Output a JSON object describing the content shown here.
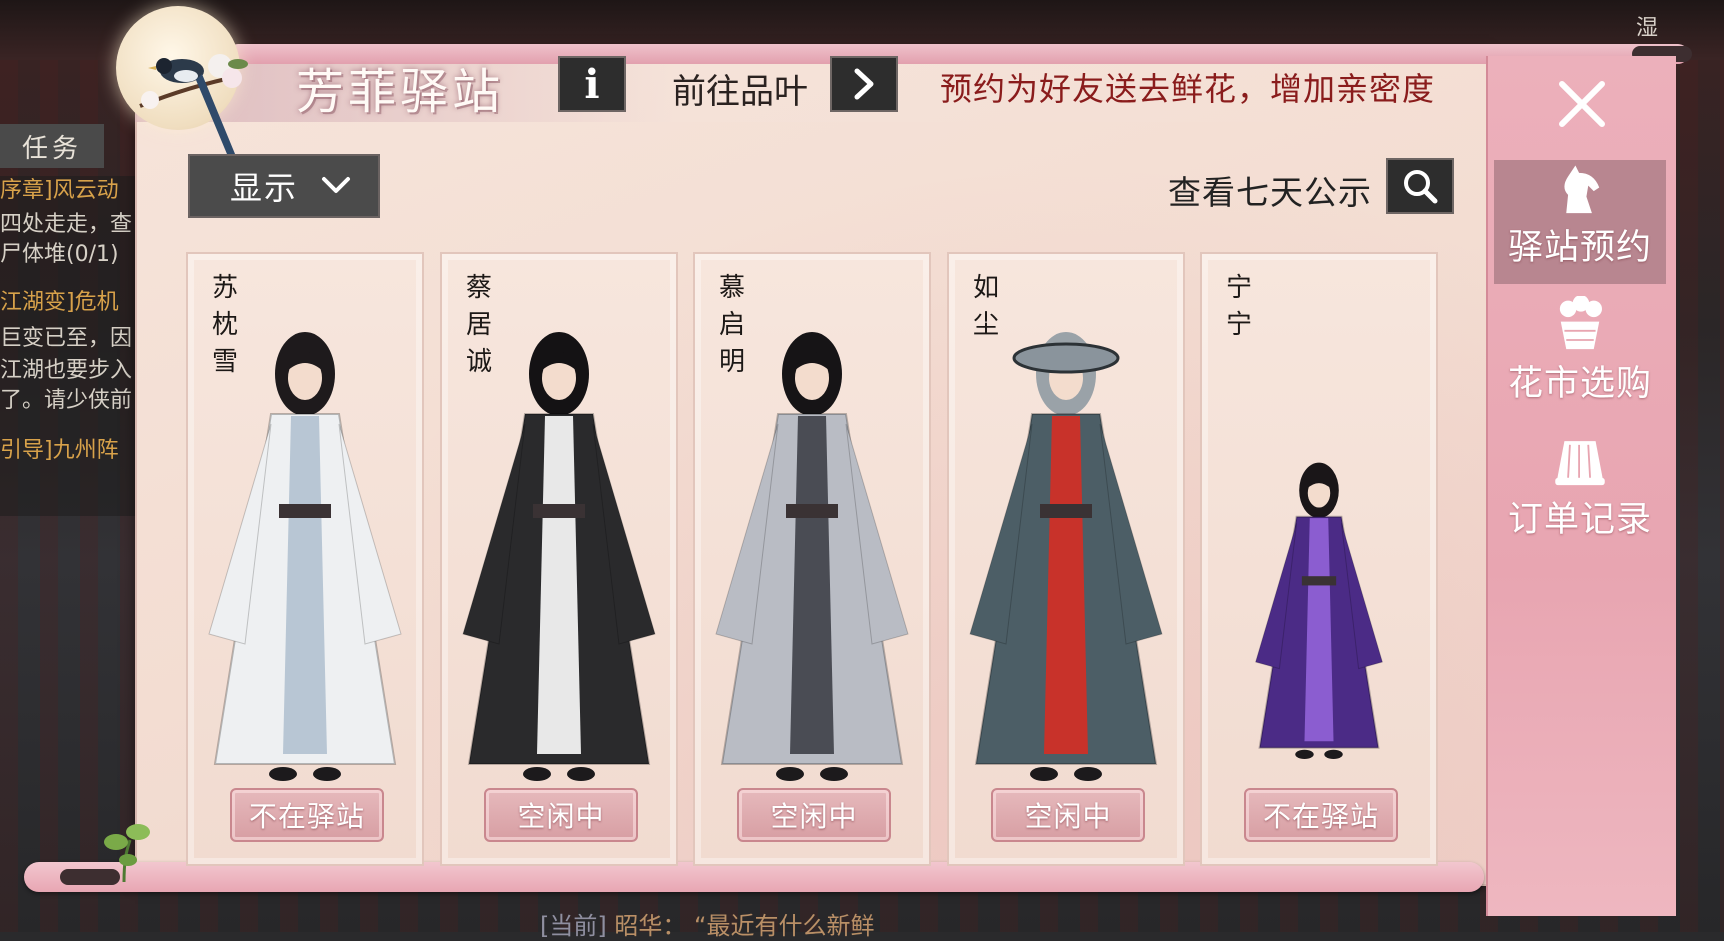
{
  "background": {
    "weather": "湿",
    "task_tab": "任务",
    "tasks": [
      {
        "title": "序章]风云动",
        "lines": [
          "四处走走，查",
          "尸体堆(0/1)"
        ]
      },
      {
        "title": "江湖变]危机",
        "lines": [
          "巨变已至，因",
          "江湖也要步入",
          "了。请少侠前"
        ]
      },
      {
        "title": "引导]九州阵",
        "lines": []
      }
    ],
    "chat": {
      "channel": "[当前]",
      "speaker": "昭华：",
      "message": "“最近有什么新鲜"
    }
  },
  "header": {
    "title": "芳菲驿站",
    "info_icon": "info-icon",
    "goto_label": "前往品叶",
    "promo": "预约为好友送去鲜花，增加亲密度"
  },
  "filter": {
    "label": "显示"
  },
  "notice": {
    "label": "查看七天公示"
  },
  "characters": [
    {
      "name": "苏枕雪",
      "status": "不在驿站",
      "robe": "#eef0f2",
      "accent": "#b8c6d4",
      "hair": "#1e1a1c"
    },
    {
      "name": "蔡居诚",
      "status": "空闲中",
      "robe": "#2a2a2c",
      "accent": "#e8e8e8",
      "hair": "#141214"
    },
    {
      "name": "慕启明",
      "status": "空闲中",
      "robe": "#b9bcc4",
      "accent": "#4a4c54",
      "hair": "#161416"
    },
    {
      "name": "如尘",
      "status": "空闲中",
      "robe": "#4c5e66",
      "accent": "#c8322a",
      "hair": "#9aa2a8"
    },
    {
      "name": "宁宁",
      "status": "不在驿站",
      "robe": "#4b2b86",
      "accent": "#8b5dd0",
      "hair": "#1a1618"
    }
  ],
  "sidebar": {
    "items": [
      {
        "label": "驿站预约",
        "icon": "horse-icon",
        "active": true
      },
      {
        "label": "花市选购",
        "icon": "flower-basket-icon",
        "active": false
      },
      {
        "label": "订单记录",
        "icon": "scroll-icon",
        "active": false
      }
    ]
  },
  "colors": {
    "panel": "#f3ddd2",
    "sidebar": "#e8a5b1",
    "sidebar_active": "#b88690",
    "status_button": "#d79ea3",
    "promo_text": "#8a1c1c"
  }
}
